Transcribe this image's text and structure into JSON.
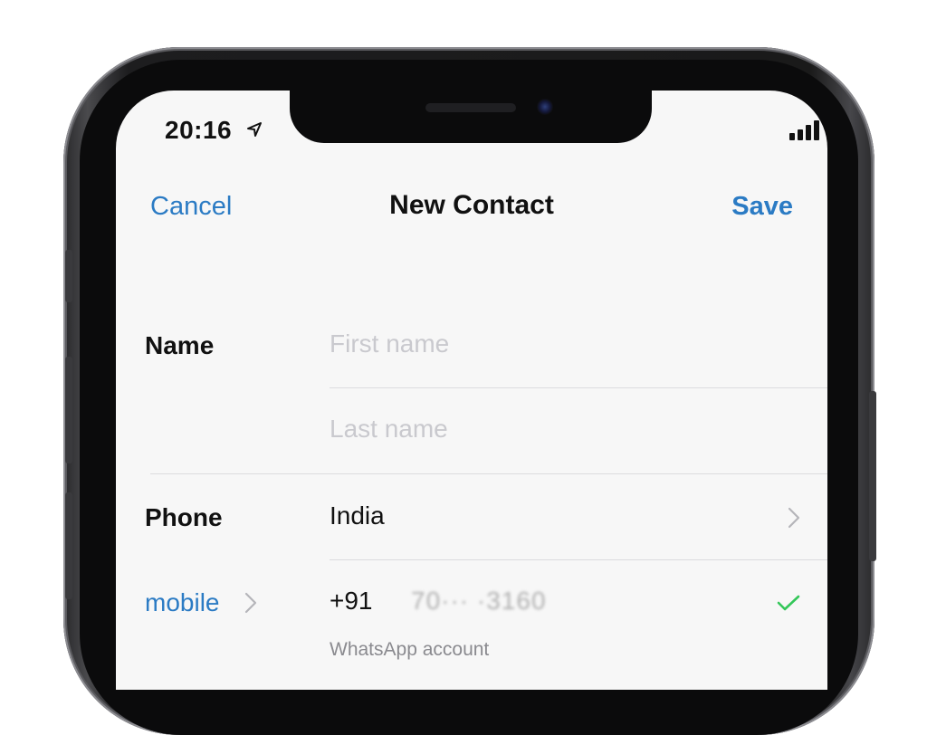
{
  "status_bar": {
    "time": "20:16"
  },
  "nav": {
    "cancel": "Cancel",
    "title": "New Contact",
    "save": "Save"
  },
  "form": {
    "name_label": "Name",
    "first_name_placeholder": "First name",
    "last_name_placeholder": "Last name",
    "phone_label": "Phone",
    "country": "India",
    "phone_type": "mobile",
    "country_code": "+91",
    "phone_number": "70··· ·3160",
    "whatsapp_note": "WhatsApp account"
  },
  "colors": {
    "accent": "#2b7bc4",
    "check": "#34c759"
  }
}
